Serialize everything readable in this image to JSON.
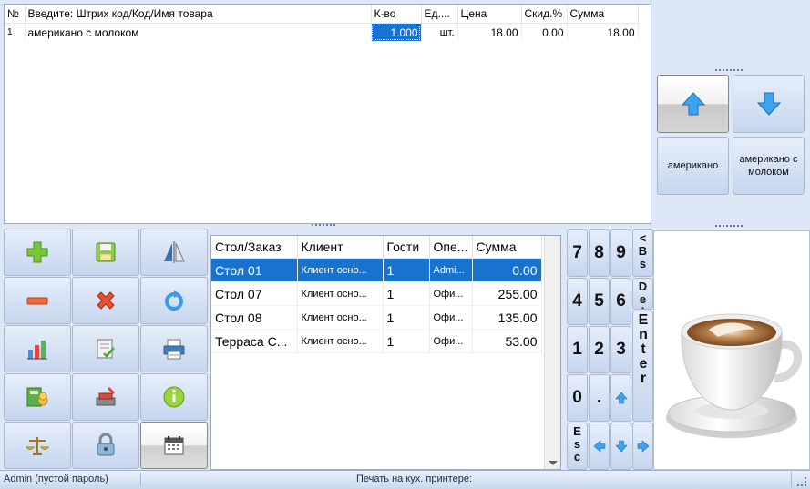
{
  "order": {
    "columns": [
      "№",
      "Введите: Штрих код/Код/Имя товара",
      "К-во",
      "Ед....",
      "Цена",
      "Скид.%",
      "Сумма"
    ],
    "rows": [
      {
        "n": "1",
        "name": "американо с молоком",
        "qty": "1.000",
        "unit": "шт.",
        "price": "18.00",
        "discount": "0.00",
        "sum": "18.00"
      }
    ]
  },
  "right_panel": {
    "products": [
      "американо",
      "американо с молоком"
    ]
  },
  "tables": {
    "columns": [
      "Стол/Заказ",
      "Клиент",
      "Гости",
      "Опе...",
      "Сумма"
    ],
    "rows": [
      {
        "table": "Стол 01",
        "client": "Клиент осно...",
        "guests": "1",
        "operator": "Admi...",
        "sum": "0.00"
      },
      {
        "table": "Стол 07",
        "client": "Клиент осно...",
        "guests": "1",
        "operator": "Офи...",
        "sum": "255.00"
      },
      {
        "table": "Стол 08",
        "client": "Клиент осно...",
        "guests": "1",
        "operator": "Офи...",
        "sum": "135.00"
      },
      {
        "table": "Терраса С...",
        "client": "Клиент осно...",
        "guests": "1",
        "operator": "Офи...",
        "sum": "53.00"
      }
    ]
  },
  "keypad": {
    "keys": [
      "7",
      "8",
      "9",
      "4",
      "5",
      "6",
      "1",
      "2",
      "3",
      "0",
      "."
    ],
    "side_backspace": "<Bs",
    "side_del": "Del",
    "side_enter": "Enter",
    "side_esc": "Esc"
  },
  "status": {
    "user": "Admin (пустой пароль)",
    "message": "Печать на кух. принтере:"
  },
  "colors": {
    "selection": "#1873cf",
    "panel": "#dde7f5",
    "button": "#c6d6ee"
  }
}
